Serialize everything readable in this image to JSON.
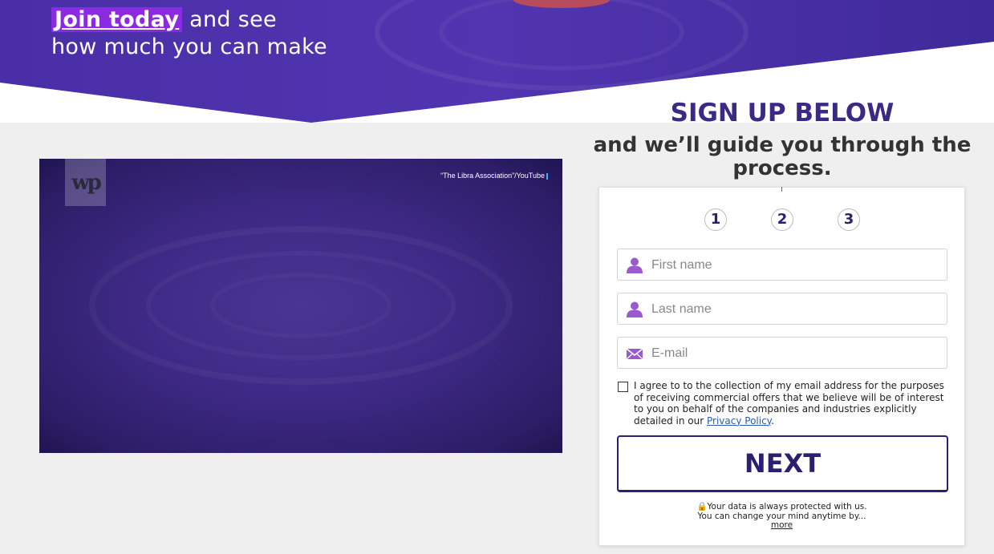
{
  "hero": {
    "highlight": "Join today",
    "line1_rest": " and see",
    "line2": "how much you can make"
  },
  "video": {
    "logo_text": "wp",
    "credit": "“The Libra Association”/YouTube"
  },
  "headings": {
    "signup": "SIGN UP BELOW",
    "guide": "and we’ll guide you through the process."
  },
  "form": {
    "steps": [
      "1",
      "2",
      "3"
    ],
    "first_name": {
      "value": "",
      "placeholder": "First name",
      "icon": "user-icon"
    },
    "last_name": {
      "value": "",
      "placeholder": "Last name",
      "icon": "user-icon"
    },
    "email": {
      "value": "",
      "placeholder": "E-mail",
      "icon": "envelope-icon"
    },
    "consent_text": "I agree to to the collection of my email address for the purposes of receiving commercial offers that we believe will be of interest to you on behalf of the companies and industries explicitly detailed in our ",
    "privacy_link": "Privacy Policy",
    "consent_end": ".",
    "consent_checked": false,
    "next_label": "NEXT",
    "footer_line1": "Your data is always protected with us.",
    "footer_line2": "You can change your mind anytime by...",
    "footer_more": "more"
  },
  "colors": {
    "brand_purple": "#3a2a85",
    "highlight": "#8a2be2",
    "icon_purple": "#9b59d0"
  }
}
